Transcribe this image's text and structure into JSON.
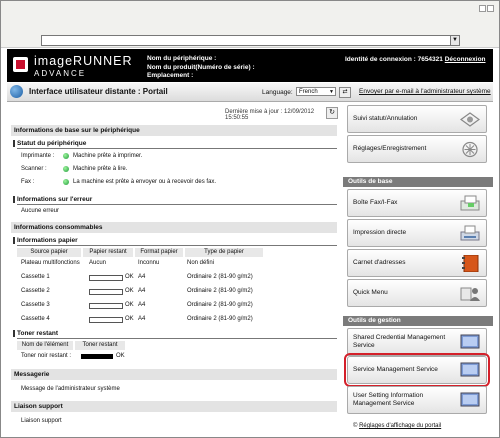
{
  "browser": {
    "address_value": "",
    "dropdown_caret": "▼"
  },
  "header": {
    "logo_line1": "imageRUNNER",
    "logo_line2": "ADVANCE",
    "device_name_label": "Nom du périphérique :",
    "product_name_label": "Nom du produit(Numéro de série) :",
    "location_label": "Emplacement :",
    "login_label": "Identité de connexion : 7654321",
    "logout_link": "Déconnexion"
  },
  "portal_bar": {
    "title": "Interface utilisateur distante : Portail",
    "language_label": "Language:",
    "language_value": "French",
    "email_link": "Envoyer par e-mail à l'administrateur système"
  },
  "main": {
    "last_update": "Dernière mise à jour : 12/09/2012 15:50:55",
    "basic_info_header": "Informations de base sur le périphérique",
    "device_status_header": "Statut du périphérique",
    "status_rows": [
      {
        "label": "Imprimante :",
        "value": "Machine prête à imprimer."
      },
      {
        "label": "Scanner :",
        "value": "Machine prête à lire."
      },
      {
        "label": "Fax :",
        "value": "La machine est prête à envoyer ou à recevoir des fax."
      }
    ],
    "error_header": "Informations sur l'erreur",
    "error_value": "Aucune erreur",
    "consumables_header": "Informations consommables",
    "paper_header": "Informations papier",
    "paper_columns": [
      "Source papier",
      "Papier restant",
      "Format papier",
      "Type de papier"
    ],
    "paper_rows": [
      {
        "source": "Plateau multifonctions",
        "remaining": "Aucun",
        "format": "Inconnu",
        "type": "Non défini",
        "bar": false
      },
      {
        "source": "Cassette 1",
        "remaining": "OK",
        "format": "A4",
        "type": "Ordinaire 2 (81-90 g/m2)",
        "bar": true
      },
      {
        "source": "Cassette 2",
        "remaining": "OK",
        "format": "A4",
        "type": "Ordinaire 2 (81-90 g/m2)",
        "bar": true
      },
      {
        "source": "Cassette 3",
        "remaining": "OK",
        "format": "A4",
        "type": "Ordinaire 2 (81-90 g/m2)",
        "bar": true
      },
      {
        "source": "Cassette 4",
        "remaining": "OK",
        "format": "A4",
        "type": "Ordinaire 2 (81-90 g/m2)",
        "bar": true
      }
    ],
    "toner_header": "Toner restant",
    "toner_columns": [
      "Nom de l'élément",
      "Toner restant"
    ],
    "toner_label": "Toner noir restant :",
    "toner_value": "OK",
    "messaging_header": "Messagerie",
    "messaging_value": "Message de l'administrateur système",
    "support_header": "Liaison support",
    "support_value": "Liaison support"
  },
  "nav": {
    "top_buttons": [
      "Suivi statut/Annulation",
      "Réglages/Enregistrement"
    ],
    "basic_tools_header": "Outils de base",
    "basic_tools": [
      "Boîte Fax/I-Fax",
      "Impression directe",
      "Carnet d'adresses",
      "Quick Menu"
    ],
    "management_header": "Outils de gestion",
    "management_tools": [
      "Shared Credential Management Service",
      "Service Management Service",
      "User Setting Information Management Service"
    ],
    "settings_link_prefix": "©",
    "settings_link": "Réglages d'affichage du portail"
  },
  "colors": {
    "highlight": "#d4202a",
    "header_bg": "#000000",
    "status_green": "#1f9a3a"
  }
}
